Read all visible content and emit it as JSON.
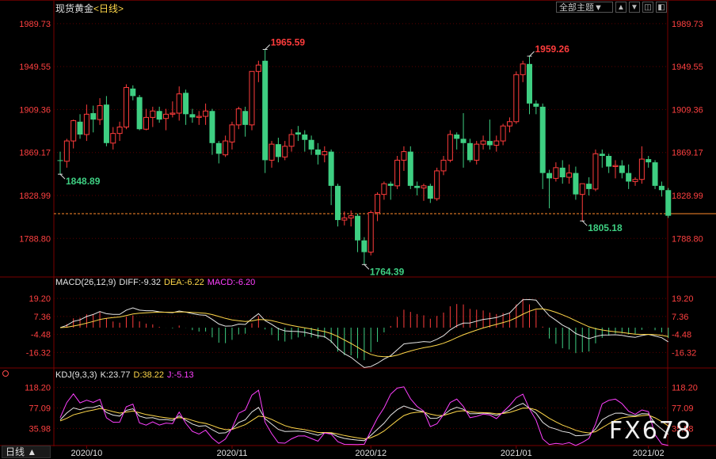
{
  "window": {
    "title": "现货黄金",
    "period": "<日线>",
    "dropdown_label": "全部主题▼",
    "buttons": [
      "▲",
      "▼",
      "◫",
      "◧"
    ],
    "period_button": "日线 ▲"
  },
  "watermark": "FX678",
  "colors": {
    "up": "#ff3c3c",
    "down": "#3ecf82",
    "white": "#e6e6e6",
    "yellow": "#ffd84a",
    "magenta": "#ff40ff",
    "grid": "#5a0000",
    "axis_label": "#ff4040"
  },
  "macd_legend": {
    "name": "MACD(26,12,9)",
    "diff": "DIFF:-9.32",
    "dea": "DEA:-6.22",
    "macd": "MACD:-6.20"
  },
  "kdj_legend": {
    "name": "KDJ(9,3,3)",
    "k": "K:23.77",
    "d": "D:38.22",
    "j": "J:-5.13"
  },
  "chart_data": [
    {
      "type": "candlestick",
      "title": "现货黄金<日线>",
      "y_ticks": [
        1989.73,
        1949.55,
        1909.36,
        1869.17,
        1828.99,
        1788.8
      ],
      "y_tick_labels": [
        "1989.73",
        "1949.55",
        "1909.36",
        "1869.17",
        "1828.99",
        "1788.80"
      ],
      "ylim": [
        1753.5,
        1998.5
      ],
      "x_tick_labels": [
        {
          "label": "2020/10",
          "date": "2020-10-01"
        },
        {
          "label": "2020/11",
          "date": "2020-11-02"
        },
        {
          "label": "2020/12",
          "date": "2020-12-01"
        },
        {
          "label": "2021/01",
          "date": "2021-01-04"
        },
        {
          "label": "2021/02",
          "date": "2021-02-01"
        }
      ],
      "last_price_line": 1812.0,
      "annotations": [
        {
          "date": "2020-09-25",
          "value": 1848.89,
          "text": "1848.89",
          "kind": "low"
        },
        {
          "date": "2020-11-09",
          "value": 1965.59,
          "text": "1965.59",
          "kind": "high"
        },
        {
          "date": "2020-11-30",
          "value": 1764.39,
          "text": "1764.39",
          "kind": "low"
        },
        {
          "date": "2021-01-06",
          "value": 1959.26,
          "text": "1959.26",
          "kind": "high"
        },
        {
          "date": "2021-01-18",
          "value": 1805.18,
          "text": "1805.18",
          "kind": "low"
        }
      ],
      "ohlc": [
        [
          "2020-09-25",
          1862,
          1870,
          1848.89,
          1861.5
        ],
        [
          "2020-09-28",
          1861,
          1882,
          1855,
          1880
        ],
        [
          "2020-09-29",
          1880,
          1900,
          1873,
          1899
        ],
        [
          "2020-09-30",
          1898,
          1905,
          1882,
          1886
        ],
        [
          "2020-10-01",
          1886,
          1914,
          1880,
          1905
        ],
        [
          "2020-10-02",
          1906,
          1913,
          1888,
          1900
        ],
        [
          "2020-10-05",
          1900,
          1920,
          1895,
          1913
        ],
        [
          "2020-10-06",
          1914,
          1922,
          1875,
          1878
        ],
        [
          "2020-10-07",
          1878,
          1893,
          1872,
          1887
        ],
        [
          "2020-10-08",
          1887,
          1898,
          1880,
          1893
        ],
        [
          "2020-10-09",
          1893,
          1933,
          1891,
          1930
        ],
        [
          "2020-10-12",
          1929,
          1932,
          1918,
          1922
        ],
        [
          "2020-10-13",
          1921,
          1923,
          1890,
          1891
        ],
        [
          "2020-10-14",
          1891,
          1910,
          1890,
          1902
        ],
        [
          "2020-10-15",
          1902,
          1912,
          1893,
          1908
        ],
        [
          "2020-10-16",
          1908,
          1912,
          1897,
          1900
        ],
        [
          "2020-10-19",
          1901,
          1910,
          1890,
          1905
        ],
        [
          "2020-10-20",
          1905,
          1917,
          1902,
          1906
        ],
        [
          "2020-10-21",
          1906,
          1931,
          1899,
          1924
        ],
        [
          "2020-10-22",
          1925,
          1928,
          1895,
          1905
        ],
        [
          "2020-10-23",
          1905,
          1910,
          1897,
          1902
        ],
        [
          "2020-10-26",
          1902,
          1908,
          1895,
          1903
        ],
        [
          "2020-10-27",
          1903,
          1915,
          1895,
          1908
        ],
        [
          "2020-10-28",
          1908,
          1910,
          1867,
          1878
        ],
        [
          "2020-10-29",
          1878,
          1880,
          1859,
          1868
        ],
        [
          "2020-10-30",
          1867,
          1885,
          1865,
          1880
        ],
        [
          "2020-11-02",
          1879,
          1898,
          1872,
          1895
        ],
        [
          "2020-11-03",
          1895,
          1912,
          1891,
          1910
        ],
        [
          "2020-11-04",
          1908,
          1912,
          1884,
          1895
        ],
        [
          "2020-11-05",
          1895,
          1945,
          1890,
          1945
        ],
        [
          "2020-11-06",
          1945,
          1955,
          1935,
          1951
        ],
        [
          "2020-11-09",
          1955,
          1965.59,
          1850,
          1862
        ],
        [
          "2020-11-10",
          1862,
          1880,
          1855,
          1877
        ],
        [
          "2020-11-11",
          1877,
          1883,
          1860,
          1865
        ],
        [
          "2020-11-12",
          1865,
          1880,
          1862,
          1875
        ],
        [
          "2020-11-13",
          1875,
          1891,
          1870,
          1886
        ],
        [
          "2020-11-16",
          1888,
          1894,
          1880,
          1886
        ],
        [
          "2020-11-17",
          1886,
          1890,
          1870,
          1881
        ],
        [
          "2020-11-18",
          1881,
          1885,
          1867,
          1872
        ],
        [
          "2020-11-19",
          1872,
          1878,
          1858,
          1867
        ],
        [
          "2020-11-20",
          1867,
          1875,
          1860,
          1870
        ],
        [
          "2020-11-23",
          1870,
          1872,
          1820,
          1838
        ],
        [
          "2020-11-24",
          1838,
          1840,
          1800,
          1806
        ],
        [
          "2020-11-25",
          1806,
          1814,
          1801,
          1808
        ],
        [
          "2020-11-26",
          1808,
          1815,
          1800,
          1810
        ],
        [
          "2020-11-27",
          1810,
          1812,
          1776,
          1787
        ],
        [
          "2020-11-30",
          1787,
          1790,
          1764.39,
          1776
        ],
        [
          "2020-12-01",
          1776,
          1815,
          1773,
          1813
        ],
        [
          "2020-12-02",
          1813,
          1832,
          1805,
          1830
        ],
        [
          "2020-12-03",
          1830,
          1842,
          1825,
          1840
        ],
        [
          "2020-12-04",
          1840,
          1842,
          1825,
          1838
        ],
        [
          "2020-12-07",
          1838,
          1866,
          1835,
          1862
        ],
        [
          "2020-12-08",
          1862,
          1875,
          1852,
          1870
        ],
        [
          "2020-12-09",
          1870,
          1875,
          1835,
          1838
        ],
        [
          "2020-12-10",
          1838,
          1842,
          1829,
          1836
        ],
        [
          "2020-12-11",
          1836,
          1840,
          1824,
          1838
        ],
        [
          "2020-12-14",
          1838,
          1840,
          1822,
          1826
        ],
        [
          "2020-12-15",
          1826,
          1855,
          1824,
          1852
        ],
        [
          "2020-12-16",
          1852,
          1866,
          1848,
          1862
        ],
        [
          "2020-12-17",
          1862,
          1890,
          1860,
          1886
        ],
        [
          "2020-12-18",
          1886,
          1888,
          1872,
          1882
        ],
        [
          "2020-12-21",
          1882,
          1906,
          1855,
          1878
        ],
        [
          "2020-12-22",
          1878,
          1882,
          1860,
          1862
        ],
        [
          "2020-12-23",
          1862,
          1880,
          1858,
          1877
        ],
        [
          "2020-12-24",
          1877,
          1885,
          1872,
          1880
        ],
        [
          "2020-12-28",
          1880,
          1900,
          1872,
          1876
        ],
        [
          "2020-12-29",
          1876,
          1885,
          1870,
          1880
        ],
        [
          "2020-12-30",
          1880,
          1896,
          1876,
          1894
        ],
        [
          "2020-12-31",
          1894,
          1902,
          1888,
          1898
        ],
        [
          "2021-01-04",
          1898,
          1945,
          1896,
          1942
        ],
        [
          "2021-01-05",
          1942,
          1955,
          1935,
          1952
        ],
        [
          "2021-01-06",
          1952,
          1959.26,
          1905,
          1915
        ],
        [
          "2021-01-07",
          1915,
          1918,
          1905,
          1912
        ],
        [
          "2021-01-08",
          1912,
          1915,
          1835,
          1850
        ],
        [
          "2021-01-11",
          1850,
          1853,
          1817,
          1845
        ],
        [
          "2021-01-12",
          1845,
          1860,
          1842,
          1855
        ],
        [
          "2021-01-13",
          1855,
          1862,
          1840,
          1846
        ],
        [
          "2021-01-14",
          1846,
          1858,
          1840,
          1850
        ],
        [
          "2021-01-15",
          1850,
          1856,
          1825,
          1830
        ],
        [
          "2021-01-18",
          1830,
          1840,
          1805.18,
          1840
        ],
        [
          "2021-01-19",
          1840,
          1846,
          1829,
          1835
        ],
        [
          "2021-01-20",
          1835,
          1872,
          1833,
          1868
        ],
        [
          "2021-01-21",
          1868,
          1872,
          1855,
          1866
        ],
        [
          "2021-01-22",
          1866,
          1868,
          1850,
          1856
        ],
        [
          "2021-01-25",
          1856,
          1862,
          1845,
          1857
        ],
        [
          "2021-01-26",
          1857,
          1862,
          1845,
          1850
        ],
        [
          "2021-01-27",
          1850,
          1858,
          1835,
          1842
        ],
        [
          "2021-01-28",
          1842,
          1846,
          1838,
          1844
        ],
        [
          "2021-01-29",
          1844,
          1875,
          1840,
          1863
        ],
        [
          "2021-02-01",
          1863,
          1866,
          1855,
          1860
        ],
        [
          "2021-02-02",
          1860,
          1862,
          1835,
          1838
        ],
        [
          "2021-02-03",
          1838,
          1842,
          1828,
          1834
        ],
        [
          "2021-02-04",
          1834,
          1836,
          1808,
          1810
        ]
      ]
    },
    {
      "type": "macd",
      "title": "MACD(26,12,9)",
      "params": [
        26,
        12,
        9
      ],
      "y_ticks": [
        19.2,
        7.36,
        -4.48,
        -16.32
      ],
      "y_tick_labels": [
        "19.20",
        "7.36",
        "-4.48",
        "-16.32"
      ],
      "ylim": [
        -26.0,
        25.0
      ],
      "last_values": {
        "diff": -9.32,
        "dea": -6.22,
        "macd": -6.2
      }
    },
    {
      "type": "kdj",
      "title": "KDJ(9,3,3)",
      "params": [
        9,
        3,
        3
      ],
      "y_ticks": [
        118.2,
        77.09,
        35.98
      ],
      "y_tick_labels": [
        "118.20",
        "77.09",
        "35.98"
      ],
      "ylim": [
        5.0,
        130.0
      ],
      "last_values": {
        "k": 23.77,
        "d": 38.22,
        "j": -5.13
      }
    }
  ]
}
